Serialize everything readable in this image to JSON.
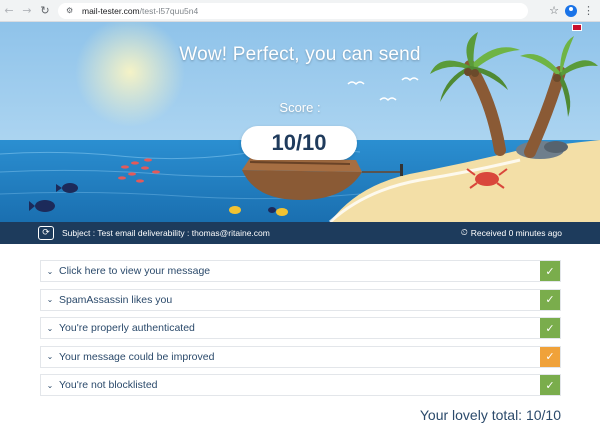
{
  "browser": {
    "url_host": "mail-tester.com",
    "url_path": "/test-l57quu5n4",
    "back_icon": "arrow-left",
    "forward_icon": "arrow-right",
    "reload_icon": "reload",
    "star_icon": "star",
    "profile_icon": "profile",
    "menu_icon": "kebab-menu"
  },
  "hero": {
    "title": "Wow! Perfect, you can send",
    "score_label": "Score :",
    "score_value": "10/10"
  },
  "info_bar": {
    "subject": "Subject : Test email deliverability : thomas@ritaine.com",
    "received": "Received 0 minutes ago"
  },
  "results": [
    {
      "label": "Click here to view your message",
      "status": "ok"
    },
    {
      "label": "SpamAssassin likes you",
      "status": "ok"
    },
    {
      "label": "You're properly authenticated",
      "status": "ok"
    },
    {
      "label": "Your message could be improved",
      "status": "warn"
    },
    {
      "label": "You're not blocklisted",
      "status": "ok"
    }
  ],
  "total": "Your lovely total: 10/10",
  "colors": {
    "info_bar": "#1d3b5c",
    "ok": "#7aad4c",
    "warn": "#f0a23a",
    "text": "#2b4a6b"
  }
}
